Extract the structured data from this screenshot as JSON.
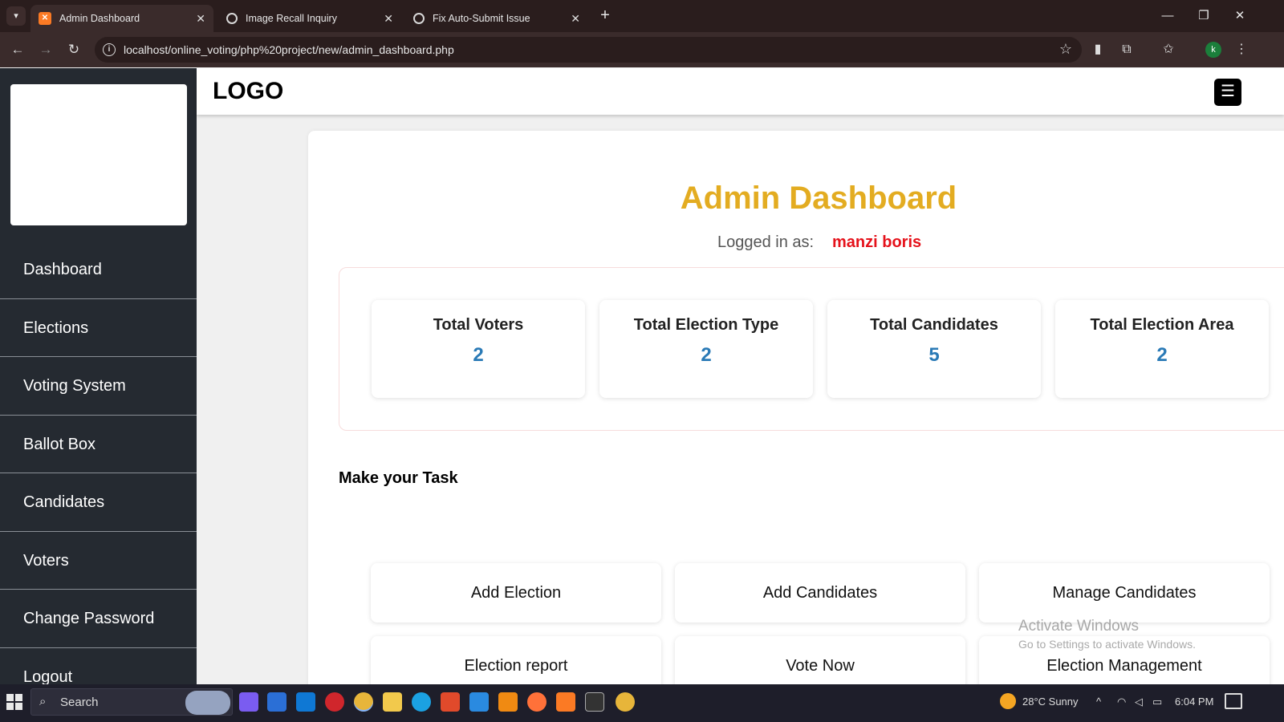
{
  "browser": {
    "tabs": [
      {
        "title": "Admin Dashboard",
        "favicon": "xampp-icon",
        "active": true
      },
      {
        "title": "Image Recall Inquiry",
        "favicon": "chatgpt-icon",
        "active": false
      },
      {
        "title": "Fix Auto-Submit Issue",
        "favicon": "chatgpt-icon",
        "active": false
      }
    ],
    "url": "localhost/online_voting/php%20project/new/admin_dashboard.php",
    "profile_initial": "k"
  },
  "sidebar": {
    "items": [
      {
        "label": "Dashboard"
      },
      {
        "label": "Elections"
      },
      {
        "label": "Voting System"
      },
      {
        "label": "Ballot Box"
      },
      {
        "label": "Candidates"
      },
      {
        "label": "Voters"
      },
      {
        "label": "Change Password"
      },
      {
        "label": "Logout"
      }
    ]
  },
  "topbar": {
    "brand": "LOGO"
  },
  "main": {
    "title": "Admin Dashboard",
    "logged_label": "Logged in as:",
    "logged_user": "manzi boris",
    "stats": [
      {
        "label": "Total Voters",
        "value": "2"
      },
      {
        "label": "Total Election Type",
        "value": "2"
      },
      {
        "label": "Total Candidates",
        "value": "5"
      },
      {
        "label": "Total Election Area",
        "value": "2"
      }
    ],
    "task_heading": "Make your Task",
    "tasks": [
      {
        "label": "Add Election"
      },
      {
        "label": "Add Candidates"
      },
      {
        "label": "Manage Candidates"
      },
      {
        "label": "Election report"
      },
      {
        "label": "Vote Now"
      },
      {
        "label": "Election Management"
      }
    ]
  },
  "watermark": {
    "line1": "Activate Windows",
    "line2": "Go to Settings to activate Windows."
  },
  "taskbar": {
    "search_placeholder": "Search",
    "weather": "28°C  Sunny",
    "time": "6:04 PM"
  },
  "colors": {
    "accent_title": "#e3ac21",
    "user_name": "#e5121b",
    "stat_value": "#2a7ab6",
    "sidebar_bg": "#252a31"
  }
}
